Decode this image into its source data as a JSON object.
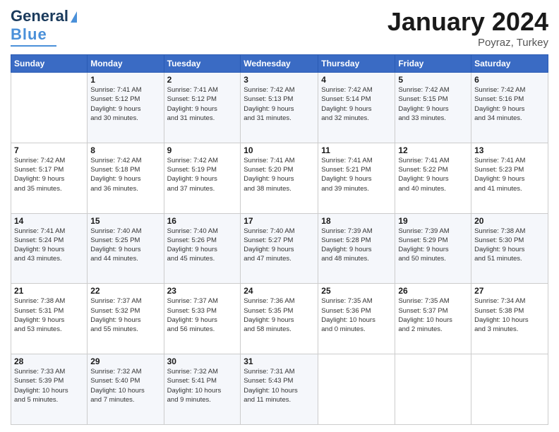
{
  "header": {
    "logo_line1": "General",
    "logo_line2": "Blue",
    "month": "January 2024",
    "location": "Poyraz, Turkey"
  },
  "days_of_week": [
    "Sunday",
    "Monday",
    "Tuesday",
    "Wednesday",
    "Thursday",
    "Friday",
    "Saturday"
  ],
  "weeks": [
    [
      {
        "day": "",
        "info": ""
      },
      {
        "day": "1",
        "info": "Sunrise: 7:41 AM\nSunset: 5:12 PM\nDaylight: 9 hours\nand 30 minutes."
      },
      {
        "day": "2",
        "info": "Sunrise: 7:41 AM\nSunset: 5:12 PM\nDaylight: 9 hours\nand 31 minutes."
      },
      {
        "day": "3",
        "info": "Sunrise: 7:42 AM\nSunset: 5:13 PM\nDaylight: 9 hours\nand 31 minutes."
      },
      {
        "day": "4",
        "info": "Sunrise: 7:42 AM\nSunset: 5:14 PM\nDaylight: 9 hours\nand 32 minutes."
      },
      {
        "day": "5",
        "info": "Sunrise: 7:42 AM\nSunset: 5:15 PM\nDaylight: 9 hours\nand 33 minutes."
      },
      {
        "day": "6",
        "info": "Sunrise: 7:42 AM\nSunset: 5:16 PM\nDaylight: 9 hours\nand 34 minutes."
      }
    ],
    [
      {
        "day": "7",
        "info": "Sunrise: 7:42 AM\nSunset: 5:17 PM\nDaylight: 9 hours\nand 35 minutes."
      },
      {
        "day": "8",
        "info": "Sunrise: 7:42 AM\nSunset: 5:18 PM\nDaylight: 9 hours\nand 36 minutes."
      },
      {
        "day": "9",
        "info": "Sunrise: 7:42 AM\nSunset: 5:19 PM\nDaylight: 9 hours\nand 37 minutes."
      },
      {
        "day": "10",
        "info": "Sunrise: 7:41 AM\nSunset: 5:20 PM\nDaylight: 9 hours\nand 38 minutes."
      },
      {
        "day": "11",
        "info": "Sunrise: 7:41 AM\nSunset: 5:21 PM\nDaylight: 9 hours\nand 39 minutes."
      },
      {
        "day": "12",
        "info": "Sunrise: 7:41 AM\nSunset: 5:22 PM\nDaylight: 9 hours\nand 40 minutes."
      },
      {
        "day": "13",
        "info": "Sunrise: 7:41 AM\nSunset: 5:23 PM\nDaylight: 9 hours\nand 41 minutes."
      }
    ],
    [
      {
        "day": "14",
        "info": "Sunrise: 7:41 AM\nSunset: 5:24 PM\nDaylight: 9 hours\nand 43 minutes."
      },
      {
        "day": "15",
        "info": "Sunrise: 7:40 AM\nSunset: 5:25 PM\nDaylight: 9 hours\nand 44 minutes."
      },
      {
        "day": "16",
        "info": "Sunrise: 7:40 AM\nSunset: 5:26 PM\nDaylight: 9 hours\nand 45 minutes."
      },
      {
        "day": "17",
        "info": "Sunrise: 7:40 AM\nSunset: 5:27 PM\nDaylight: 9 hours\nand 47 minutes."
      },
      {
        "day": "18",
        "info": "Sunrise: 7:39 AM\nSunset: 5:28 PM\nDaylight: 9 hours\nand 48 minutes."
      },
      {
        "day": "19",
        "info": "Sunrise: 7:39 AM\nSunset: 5:29 PM\nDaylight: 9 hours\nand 50 minutes."
      },
      {
        "day": "20",
        "info": "Sunrise: 7:38 AM\nSunset: 5:30 PM\nDaylight: 9 hours\nand 51 minutes."
      }
    ],
    [
      {
        "day": "21",
        "info": "Sunrise: 7:38 AM\nSunset: 5:31 PM\nDaylight: 9 hours\nand 53 minutes."
      },
      {
        "day": "22",
        "info": "Sunrise: 7:37 AM\nSunset: 5:32 PM\nDaylight: 9 hours\nand 55 minutes."
      },
      {
        "day": "23",
        "info": "Sunrise: 7:37 AM\nSunset: 5:33 PM\nDaylight: 9 hours\nand 56 minutes."
      },
      {
        "day": "24",
        "info": "Sunrise: 7:36 AM\nSunset: 5:35 PM\nDaylight: 9 hours\nand 58 minutes."
      },
      {
        "day": "25",
        "info": "Sunrise: 7:35 AM\nSunset: 5:36 PM\nDaylight: 10 hours\nand 0 minutes."
      },
      {
        "day": "26",
        "info": "Sunrise: 7:35 AM\nSunset: 5:37 PM\nDaylight: 10 hours\nand 2 minutes."
      },
      {
        "day": "27",
        "info": "Sunrise: 7:34 AM\nSunset: 5:38 PM\nDaylight: 10 hours\nand 3 minutes."
      }
    ],
    [
      {
        "day": "28",
        "info": "Sunrise: 7:33 AM\nSunset: 5:39 PM\nDaylight: 10 hours\nand 5 minutes."
      },
      {
        "day": "29",
        "info": "Sunrise: 7:32 AM\nSunset: 5:40 PM\nDaylight: 10 hours\nand 7 minutes."
      },
      {
        "day": "30",
        "info": "Sunrise: 7:32 AM\nSunset: 5:41 PM\nDaylight: 10 hours\nand 9 minutes."
      },
      {
        "day": "31",
        "info": "Sunrise: 7:31 AM\nSunset: 5:43 PM\nDaylight: 10 hours\nand 11 minutes."
      },
      {
        "day": "",
        "info": ""
      },
      {
        "day": "",
        "info": ""
      },
      {
        "day": "",
        "info": ""
      }
    ]
  ]
}
